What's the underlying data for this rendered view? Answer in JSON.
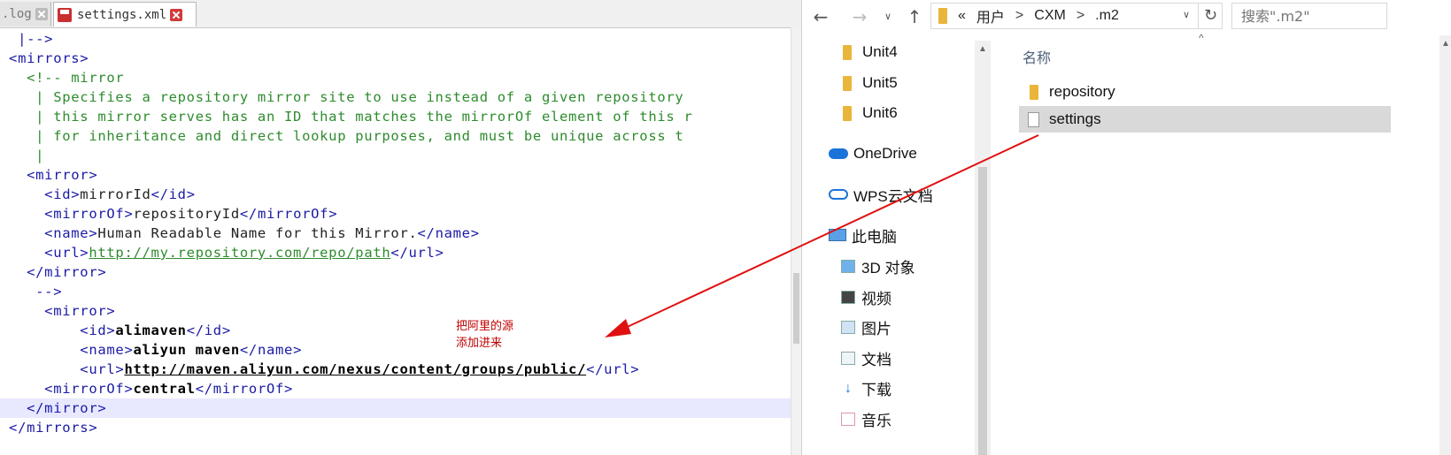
{
  "editor": {
    "tabs": [
      {
        "label": ".log"
      },
      {
        "label": "settings.xml"
      }
    ],
    "lines": [
      {
        "segs": [
          {
            "t": "  |-->",
            "c": "tg"
          }
        ]
      },
      {
        "segs": [
          {
            "t": " <mirrors>",
            "c": "tg"
          }
        ]
      },
      {
        "segs": [
          {
            "t": "   <!-- mirror",
            "c": "cm"
          }
        ]
      },
      {
        "segs": [
          {
            "t": "    | Specifies a repository mirror site to use instead of a given repository",
            "c": "cm"
          }
        ]
      },
      {
        "segs": [
          {
            "t": "    | this mirror serves has an ID that matches the mirrorOf element of this r",
            "c": "cm"
          }
        ]
      },
      {
        "segs": [
          {
            "t": "    | for inheritance and direct lookup purposes, and must be unique across t",
            "c": "cm"
          }
        ]
      },
      {
        "segs": [
          {
            "t": "    |",
            "c": "cm"
          }
        ]
      },
      {
        "segs": [
          {
            "t": "   <mirror>",
            "c": "tg"
          }
        ]
      },
      {
        "segs": [
          {
            "t": "     <id>",
            "c": "tg"
          },
          {
            "t": "mirrorId",
            "c": "tx"
          },
          {
            "t": "</id>",
            "c": "tg"
          }
        ]
      },
      {
        "segs": [
          {
            "t": "     <mirrorOf>",
            "c": "tg"
          },
          {
            "t": "repositoryId",
            "c": "tx"
          },
          {
            "t": "</mirrorOf>",
            "c": "tg"
          }
        ]
      },
      {
        "segs": [
          {
            "t": "     <name>",
            "c": "tg"
          },
          {
            "t": "Human Readable Name for this Mirror.",
            "c": "tx"
          },
          {
            "t": "</name>",
            "c": "tg"
          }
        ]
      },
      {
        "segs": [
          {
            "t": "     <url>",
            "c": "tg"
          },
          {
            "t": "http://my.repository.com/repo/path",
            "c": "lk"
          },
          {
            "t": "</url>",
            "c": "tg"
          }
        ]
      },
      {
        "segs": [
          {
            "t": "   </mirror>",
            "c": "tg"
          }
        ]
      },
      {
        "segs": [
          {
            "t": "    -->",
            "c": "tg"
          }
        ]
      },
      {
        "segs": [
          {
            "t": "     <mirror>",
            "c": "tg"
          }
        ]
      },
      {
        "segs": [
          {
            "t": "         <id>",
            "c": "tg"
          },
          {
            "t": "alimaven",
            "c": "bd"
          },
          {
            "t": "</id>",
            "c": "tg"
          }
        ]
      },
      {
        "segs": [
          {
            "t": "         <name>",
            "c": "tg"
          },
          {
            "t": "aliyun maven",
            "c": "bd"
          },
          {
            "t": "</name>",
            "c": "tg"
          }
        ]
      },
      {
        "segs": [
          {
            "t": "         <url>",
            "c": "tg"
          },
          {
            "t": "http://maven.aliyun.com/nexus/content/groups/public/",
            "c": "lkb"
          },
          {
            "t": "</url>",
            "c": "tg"
          }
        ]
      },
      {
        "segs": [
          {
            "t": "     <mirrorOf>",
            "c": "tg"
          },
          {
            "t": "central",
            "c": "bd"
          },
          {
            "t": "</mirrorOf>",
            "c": "tg"
          }
        ]
      },
      {
        "segs": [
          {
            "t": "   </mirror>",
            "c": "tg"
          }
        ],
        "highlight": true
      },
      {
        "segs": [
          {
            "t": " </mirrors>",
            "c": "tg"
          }
        ]
      }
    ],
    "note_line1": "把阿里的源",
    "note_line2": "添加进来"
  },
  "explorer": {
    "address": {
      "prefix": "«",
      "segments": [
        "用户",
        "CXM",
        ".m2"
      ],
      "separator": ">"
    },
    "search_placeholder": "搜索\".m2\"",
    "nav_items": [
      "Unit4",
      "Unit5",
      "Unit6",
      "OneDrive",
      "WPS云文档",
      "此电脑",
      "3D 对象",
      "视频",
      "图片",
      "文档",
      "下载",
      "音乐"
    ],
    "column_header": "名称",
    "files": [
      {
        "name": "repository"
      },
      {
        "name": "settings"
      }
    ]
  },
  "colors": {
    "tag": "#1a1aa6",
    "comment": "#2e8b2e",
    "note": "#c00000",
    "arrow": "#e01010",
    "selected_row": "#d9d9d9"
  }
}
